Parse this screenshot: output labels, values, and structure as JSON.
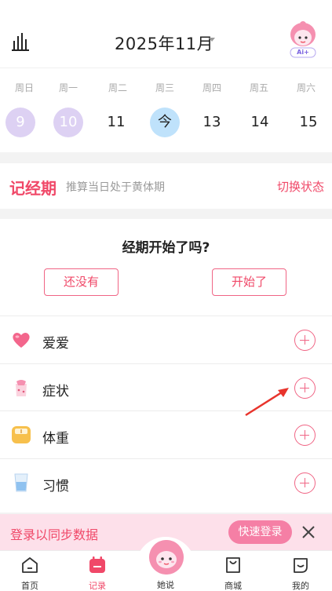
{
  "header": {
    "month": "2025年11月",
    "ai_badge": "Ai+"
  },
  "week": {
    "weekdays": [
      "周日",
      "周一",
      "周二",
      "周三",
      "周四",
      "周五",
      "周六"
    ],
    "days": [
      "9",
      "10",
      "11",
      "今",
      "13",
      "14",
      "15"
    ]
  },
  "period": {
    "title": "记经期",
    "subtitle": "推算当日处于黄体期",
    "switch_label": "切换状态"
  },
  "card": {
    "question": "经期开始了吗?",
    "not_yet": "还没有",
    "started": "开始了",
    "items": [
      {
        "label": "爱爱",
        "icon": "heart-icon"
      },
      {
        "label": "症状",
        "icon": "symptom-icon"
      },
      {
        "label": "体重",
        "icon": "scale-icon"
      },
      {
        "label": "习惯",
        "icon": "water-cup-icon"
      }
    ]
  },
  "login": {
    "text": "登录以同步数据",
    "button": "快速登录"
  },
  "nav": {
    "items": [
      {
        "label": "首页"
      },
      {
        "label": "记录"
      },
      {
        "label": "她说"
      },
      {
        "label": "商城"
      },
      {
        "label": "我的"
      }
    ]
  },
  "colors": {
    "accent": "#f04868",
    "period_day": "#ddd1f3",
    "today": "#bfe2fb",
    "login_bg": "#fde0ea"
  }
}
